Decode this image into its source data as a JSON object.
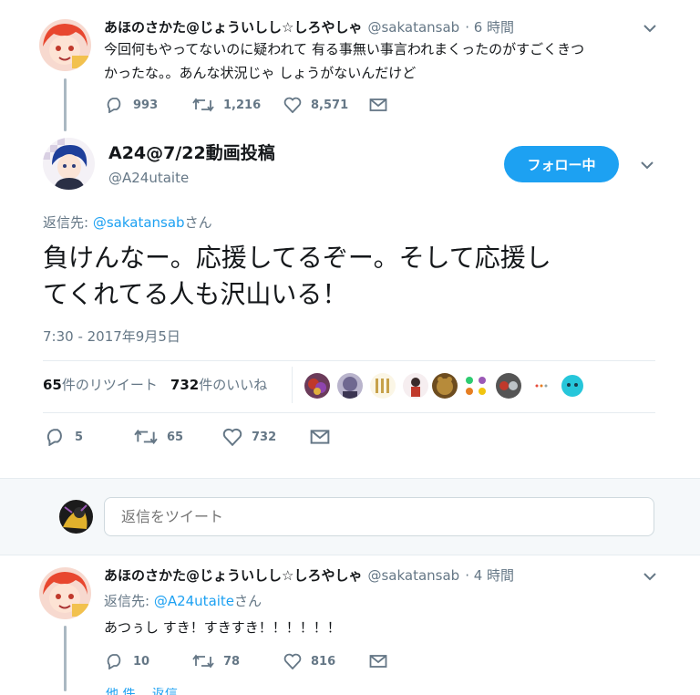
{
  "tweet1": {
    "display_name": "あほのさかた@じょういしし☆しろやしゃ",
    "handle": "@sakatansab",
    "time": "· 6 時間",
    "text_line1": "今回何もやってないのに疑われて 有る事無い事言われまくったのがすごくきつ",
    "text_line2": "かったな。。あんな状況じゃ しょうがないんだけど",
    "replies": "993",
    "retweets": "1,216",
    "likes": "8,571"
  },
  "main_tweet": {
    "display_name": "A24@7/22動画投稿",
    "handle": "@A24utaite",
    "follow_label": "フォロー中",
    "reply_to_prefix": "返信先: ",
    "reply_to_handle": "@sakatansab",
    "reply_to_suffix": "さん",
    "text_line1": "負けんなー。応援してるぞー。そして応援し",
    "text_line2": "てくれてる人も沢山いる！",
    "timestamp": "7:30 - 2017年9月5日",
    "retweet_count": "65",
    "retweet_label": "件のリツイート",
    "like_count": "732",
    "like_label": "件のいいね",
    "replies": "5",
    "retweets": "65",
    "likes": "732"
  },
  "composer": {
    "placeholder": "返信をツイート"
  },
  "tweet3": {
    "display_name": "あほのさかた@じょういしし☆しろやしゃ",
    "handle": "@sakatansab",
    "time": "· 4 時間",
    "reply_to_prefix": "返信先: ",
    "reply_to_handle": "@A24utaite",
    "reply_to_suffix": "さん",
    "text": "あつぅし すき！すきすき！！！！！！",
    "replies": "10",
    "retweets": "78",
    "likes": "816",
    "partial_text": "他 件… 返信"
  },
  "colors": {
    "accent": "#1da1f2",
    "thread_line": "#aab8c2",
    "muted": "#657786",
    "composer_bg": "#f5f8fa"
  }
}
